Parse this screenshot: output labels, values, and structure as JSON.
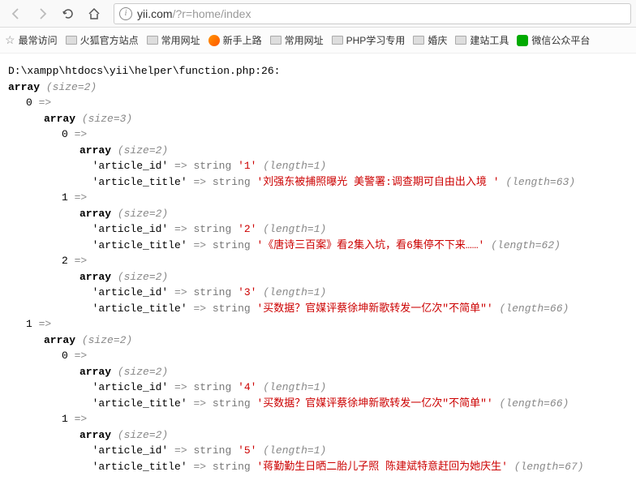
{
  "toolbar": {
    "url_prefix": "yii.com",
    "url_query": "/?r=home/index"
  },
  "bookmarks": {
    "most_visited": "最常访问",
    "items": [
      "火狐官方站点",
      "常用网址",
      "新手上路",
      "常用网址",
      "PHP学习专用",
      "婚庆",
      "建站工具",
      "微信公众平台"
    ]
  },
  "dump": {
    "path": "D:\\xampp\\htdocs\\yii\\helper\\function.php:26:",
    "array_kw": "array",
    "size": "(size=2)",
    "arrow": "=>",
    "string_kw": "string",
    "groups": [
      {
        "key": "0",
        "size": "(size=3)",
        "items": [
          {
            "key": "0",
            "id": "1",
            "id_len": "1",
            "title": "刘强东被捕照曝光 美警署:调查期可自由出入境 ",
            "title_len": "63"
          },
          {
            "key": "1",
            "id": "2",
            "id_len": "1",
            "title": "《唐诗三百案》看2集入坑，看6集停不下来……",
            "title_len": "62"
          },
          {
            "key": "2",
            "id": "3",
            "id_len": "1",
            "title": "买数据？官媒评蔡徐坤新歌转发一亿次\"不简单\"",
            "title_len": "66"
          }
        ]
      },
      {
        "key": "1",
        "size": "(size=2)",
        "items": [
          {
            "key": "0",
            "id": "4",
            "id_len": "1",
            "title": "买数据？官媒评蔡徐坤新歌转发一亿次\"不简单\"",
            "title_len": "66"
          },
          {
            "key": "1",
            "id": "5",
            "id_len": "1",
            "title": "蒋勤勤生日晒二胎儿子照 陈建斌特意赶回为她庆生",
            "title_len": "67"
          }
        ]
      }
    ],
    "fields": {
      "id": "'article_id'",
      "title": "'article_title'",
      "inner_size": "(size=2)"
    }
  }
}
